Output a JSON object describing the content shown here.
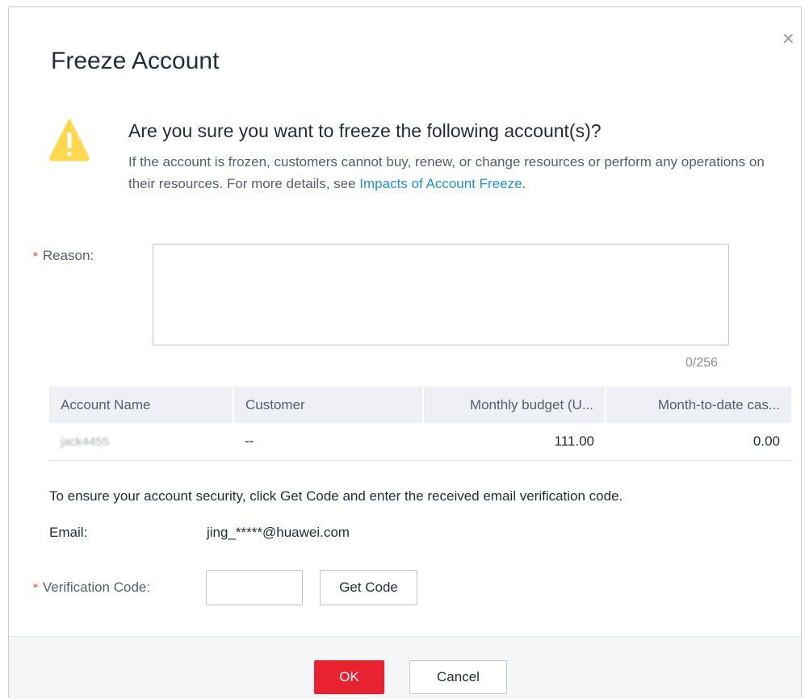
{
  "dialog": {
    "title": "Freeze Account",
    "close_icon": "close-icon"
  },
  "warning": {
    "icon": "warning-triangle-icon",
    "heading": "Are you sure you want to freeze the following account(s)?",
    "description": "If the account is frozen, customers cannot buy, renew, or change resources or perform any operations on their resources. For more details, see ",
    "link_text": "Impacts of Account Freeze",
    "suffix": "."
  },
  "reason": {
    "required_mark": "*",
    "label": "Reason:",
    "value": "",
    "counter": "0/256"
  },
  "table": {
    "headers": [
      "Account Name",
      "Customer",
      "Monthly budget (U...",
      "Month-to-date cas..."
    ],
    "rows": [
      {
        "account_name": "jack4455",
        "customer": "--",
        "monthly_budget": "111.00",
        "month_to_date": "0.00"
      }
    ]
  },
  "verification": {
    "note": "To ensure your account security, click Get Code and enter the received email verification code.",
    "email_label": "Email:",
    "email_value": "jing_*****@huawei.com",
    "required_mark": "*",
    "code_label": "Verification Code:",
    "code_value": "",
    "get_code_label": "Get Code"
  },
  "footer": {
    "ok_label": "OK",
    "cancel_label": "Cancel"
  },
  "colors": {
    "accent_red": "#e8222f",
    "link_blue": "#1e90e6",
    "warning_yellow": "#ffd84e",
    "required_red": "#f24141"
  }
}
